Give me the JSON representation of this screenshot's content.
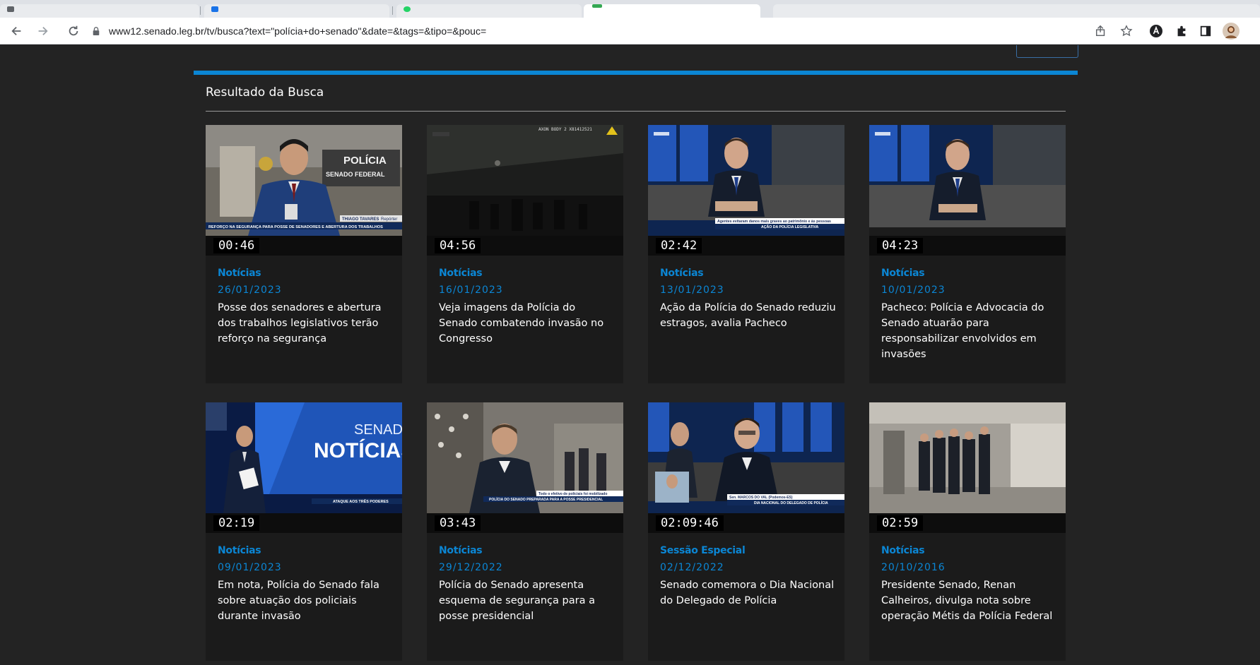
{
  "browser": {
    "url": "www12.senado.leg.br/tv/busca?text=\"polícia+do+senado\"&date=&tags=&tipo=&pouc=",
    "icons": [
      "back-arrow-icon",
      "forward-arrow-icon",
      "reload-icon",
      "lock-icon",
      "share-icon",
      "star-icon",
      "extension-a-icon",
      "puzzle-icon",
      "sidebar-icon",
      "profile-avatar"
    ]
  },
  "search": {
    "heading": "Resultado da Busca"
  },
  "results": [
    {
      "duration": "00:46",
      "category": "Notícias",
      "date": "26/01/2023",
      "title": "Posse dos senadores e abertura dos trabalhos legislativos terão reforço na segurança"
    },
    {
      "duration": "04:56",
      "category": "Notícias",
      "date": "16/01/2023",
      "title": "Veja imagens da Polícia do Senado combatendo invasão no Congresso"
    },
    {
      "duration": "02:42",
      "category": "Notícias",
      "date": "13/01/2023",
      "title": "Ação da Polícia do Senado reduziu estragos, avalia Pacheco"
    },
    {
      "duration": "04:23",
      "category": "Notícias",
      "date": "10/01/2023",
      "title": "Pacheco: Polícia e Advocacia do Senado atuarão para responsabilizar envolvidos em invasões"
    },
    {
      "duration": "02:19",
      "category": "Notícias",
      "date": "09/01/2023",
      "title": "Em nota, Polícia do Senado fala sobre atuação dos policiais durante invasão"
    },
    {
      "duration": "03:43",
      "category": "Notícias",
      "date": "29/12/2022",
      "title": "Polícia do Senado apresenta esquema de segurança para a posse presidencial"
    },
    {
      "duration": "02:09:46",
      "category": "Sessão Especial",
      "date": "02/12/2022",
      "title": "Senado comemora o Dia Nacional do Delegado de Polícia"
    },
    {
      "duration": "02:59",
      "category": "Notícias",
      "date": "20/10/2016",
      "title": "Presidente Senado, Renan Calheiros, divulga nota sobre operação Métis da Polícia Federal"
    }
  ],
  "thumb_text": {
    "t1_sign_a": "POLÍCIA",
    "t1_sign_b": "SENADO FEDERAL",
    "t1_lower": "REFORÇO NA SEGURANÇA PARA POSSE DE SENADORES E ABERTURA DOS TRABALHOS",
    "t1_name": "THIAGO TAVARES",
    "t1_role": "Repórter",
    "t2_cam": "AXON BODY 2 X81412521",
    "t3_lower_a": "Agentes evitaram danos mais graves ao patrimônio e às pessoas",
    "t3_lower_b": "AÇÃO DA POLÍCIA LEGISLATIVA",
    "t5_a": "SENADO",
    "t5_b": "NOTÍCIAS",
    "t5_lower": "ATAQUE AOS TRÊS PODERES",
    "t6_lower_a": "Todo o efetivo de policiais foi mobilizado",
    "t6_lower_b": "POLÍCIA DO SENADO PREPARADA PARA A POSSE PRESIDENCIAL",
    "t7_name": "Sen. MARCOS DO VAL (Podemos-ES)",
    "t7_lower": "DIA NACIONAL DO DELEGADO DE POLÍCIA"
  },
  "colors": {
    "accent": "#0b86d4",
    "page_bg": "#232323",
    "card_bg": "#1b1b1b"
  }
}
